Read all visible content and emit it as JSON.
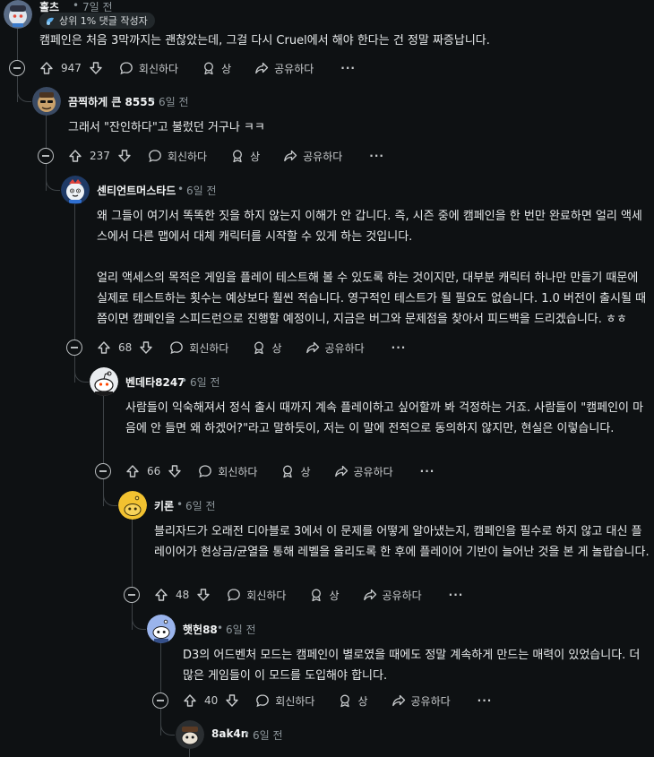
{
  "labels": {
    "reply": "회신하다",
    "award": "상",
    "share": "공유하다",
    "more": "···",
    "sep": "•"
  },
  "comments": [
    {
      "author": "홀츠",
      "time": "7일 전",
      "flair": "상위 1% 댓글 작성자",
      "body": [
        "캠페인은 처음 3막까지는 괜찮았는데, 그걸 다시 Cruel에서 해야 한다는 건 정말 짜증납니다."
      ],
      "score": "947"
    },
    {
      "author": "끔찍하게 큰 8555",
      "time": "6일 전",
      "body": [
        "그래서 \"잔인하다\"고 불렀던 거구나 ㅋㅋ"
      ],
      "score": "237"
    },
    {
      "author": "센티언트머스타드",
      "time": "6일 전",
      "body": [
        "왜 그들이 여기서 똑똑한 짓을 하지 않는지 이해가 안 갑니다. 즉, 시즌 중에 캠페인을 한 번만 완료하면 얼리 액세스에서 다른 맵에서 대체 캐릭터를 시작할 수 있게 하는 것입니다.",
        "얼리 액세스의 목적은 게임을 플레이 테스트해 볼 수 있도록 하는 것이지만, 대부분 캐릭터 하나만 만들기 때문에 실제로 테스트하는 횟수는 예상보다 훨씬 적습니다. 영구적인 테스트가 될 필요도 없습니다. 1.0 버전이 출시될 때쯤이면 캠페인을 스피드런으로 진행할 예정이니, 지금은 버그와 문제점을 찾아서 피드백을 드리겠습니다. ㅎㅎ"
      ],
      "score": "68"
    },
    {
      "author": "벤데타8247",
      "time": "6일 전",
      "body": [
        "사람들이 익숙해져서 정식 출시 때까지 계속 플레이하고 싶어할까 봐 걱정하는 거죠. 사람들이 \"캠페인이 마음에 안 들면 왜 하겠어?\"라고 말하듯이, 저는 이 말에 전적으로 동의하지 않지만, 현실은 이렇습니다."
      ],
      "score": "66"
    },
    {
      "author": "키론",
      "time": "6일 전",
      "body": [
        "블리자드가 오래전 디아블로 3에서 이 문제를 어떻게 알아냈는지, 캠페인을 필수로 하지 않고 대신 플레이어가 현상금/균열을 통해 레벨을 올리도록 한 후에 플레이어 기반이 늘어난 것을 본 게 놀랍습니다."
      ],
      "score": "48"
    },
    {
      "author": "햇헌88",
      "time": "6일 전",
      "body": [
        "D3의 어드벤처 모드는 캠페인이 별로였을 때에도 정말 계속하게 만드는 매력이 있었습니다. 더 많은 게임들이 이 모드를 도입해야 합니다."
      ],
      "score": "40"
    },
    {
      "author": "8ak4n",
      "time": "6일 전",
      "body": [],
      "score": ""
    }
  ]
}
